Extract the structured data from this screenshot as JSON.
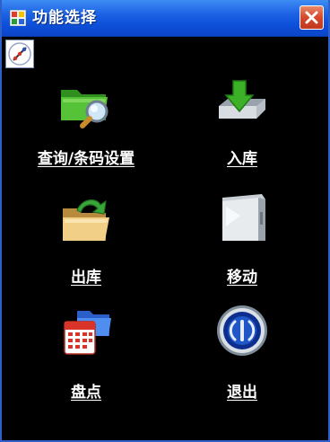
{
  "window": {
    "title": "功能选择"
  },
  "menu": {
    "items": [
      {
        "label": "查询/条码设置",
        "icon": "folder-search-icon"
      },
      {
        "label": "入库",
        "icon": "download-arrow-icon"
      },
      {
        "label": "出库",
        "icon": "folder-export-icon"
      },
      {
        "label": "移动",
        "icon": "move-box-icon"
      },
      {
        "label": "盘点",
        "icon": "calendar-folder-icon"
      },
      {
        "label": "退出",
        "icon": "exit-button-icon"
      }
    ]
  },
  "colors": {
    "titlebar": "#1c61e3",
    "background": "#000000",
    "label": "#ffffff",
    "close": "#d4482a"
  }
}
